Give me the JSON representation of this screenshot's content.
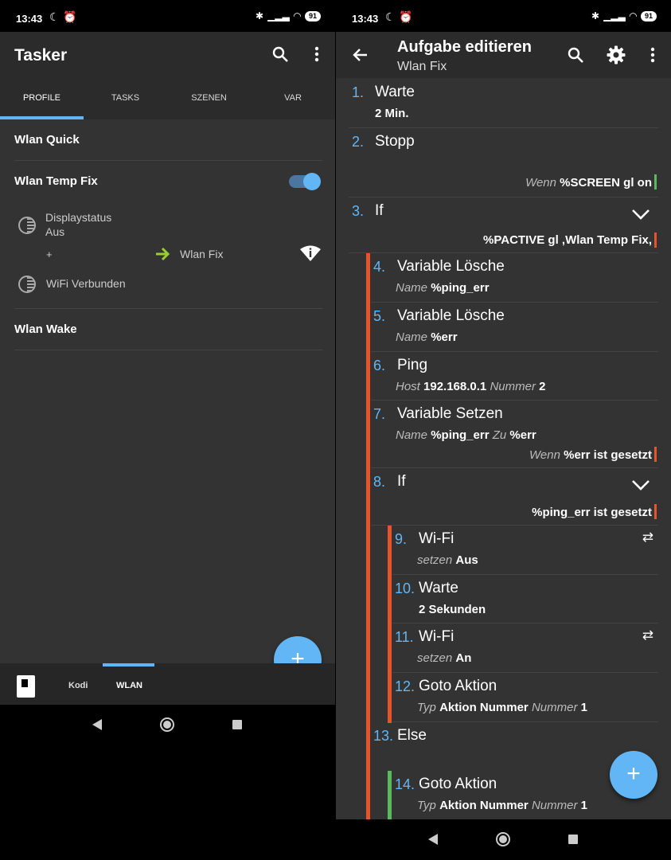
{
  "status": {
    "time": "13:43",
    "battery": "91"
  },
  "left": {
    "app_title": "Tasker",
    "tabs": [
      "PROFILE",
      "TASKS",
      "SZENEN",
      "VAR"
    ],
    "profiles": [
      "Wlan Quick",
      "Wlan Temp Fix",
      "Wlan Wake"
    ],
    "context1_line1": "Displaystatus",
    "context1_line2": "Aus",
    "plus": "+",
    "linked_task": "Wlan Fix",
    "context2": "WiFi Verbunden",
    "projects": [
      "Kodi",
      "WLAN"
    ],
    "fab": "+"
  },
  "right": {
    "title": "Aufgabe editieren",
    "subtitle": "Wlan Fix",
    "fab": "+",
    "actions": [
      {
        "num": "1.",
        "name": "Warte",
        "arg": "2 Min."
      },
      {
        "num": "2.",
        "name": "Stopp",
        "cond_label": "Wenn",
        "cond": "%SCREEN gl on"
      },
      {
        "num": "3.",
        "name": "If",
        "cond": "%PACTIVE gl ,Wlan Temp Fix,"
      },
      {
        "num": "4.",
        "name": "Variable Lösche",
        "k1": "Name",
        "v1": "%ping_err"
      },
      {
        "num": "5.",
        "name": "Variable Lösche",
        "k1": "Name",
        "v1": "%err"
      },
      {
        "num": "6.",
        "name": "Ping",
        "k1": "Host",
        "v1": "192.168.0.1",
        "k2": "Nummer",
        "v2": "2"
      },
      {
        "num": "7.",
        "name": "Variable Setzen",
        "k1": "Name",
        "v1": "%ping_err",
        "k2": "Zu",
        "v2": "%err",
        "cond_label": "Wenn",
        "cond": "%err ist gesetzt"
      },
      {
        "num": "8.",
        "name": "If",
        "cond": "%ping_err ist gesetzt"
      },
      {
        "num": "9.",
        "name": "Wi-Fi",
        "k1": "setzen",
        "v1": "Aus"
      },
      {
        "num": "10.",
        "name": "Warte",
        "arg": "2 Sekunden"
      },
      {
        "num": "11.",
        "name": "Wi-Fi",
        "k1": "setzen",
        "v1": "An"
      },
      {
        "num": "12.",
        "name": "Goto Aktion",
        "k1": "Typ",
        "v1": "Aktion Nummer",
        "k2": "Nummer",
        "v2": "1"
      },
      {
        "num": "13.",
        "name": "Else"
      },
      {
        "num": "14.",
        "name": "Goto Aktion",
        "k1": "Typ",
        "v1": "Aktion Nummer",
        "k2": "Nummer",
        "v2": "1"
      }
    ]
  },
  "colors": {
    "accent": "#62b6f5",
    "orange_bar": "#e5542a",
    "green_bar": "#5cb85c",
    "task_arrow": "#9acd32"
  },
  "icons": [
    "search-icon",
    "more-vert-icon",
    "back-arrow-icon",
    "settings-gear-icon",
    "chevron-down-icon",
    "swap-arrows-icon",
    "wifi-info-icon",
    "arrow-right-icon",
    "project-icon"
  ]
}
